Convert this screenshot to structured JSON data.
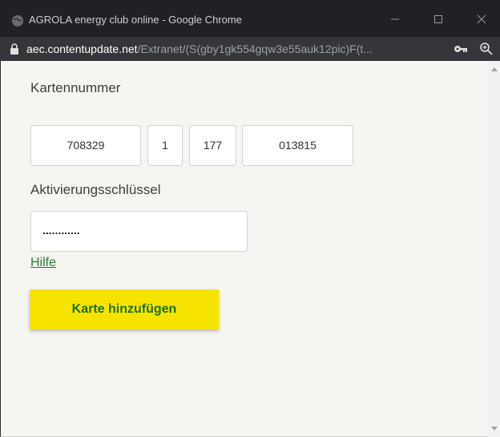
{
  "browser": {
    "title": "AGROLA energy club online - Google Chrome",
    "url_host": "aec.contentupdate.net",
    "url_path": "/Extranet/(S(gby1gk554gqw3e55auk12pic)F(t..."
  },
  "form": {
    "card_label": "Kartennummer",
    "card_parts": [
      "708329",
      "1",
      "177",
      "013815"
    ],
    "key_label": "Aktivierungsschlüssel",
    "key_value": "............",
    "help_link": "Hilfe",
    "submit_label": "Karte hinzufügen"
  },
  "colors": {
    "button_bg": "#f6e300",
    "button_text": "#1f6e1f",
    "link": "#2e7d32",
    "title_bar": "#202124"
  }
}
